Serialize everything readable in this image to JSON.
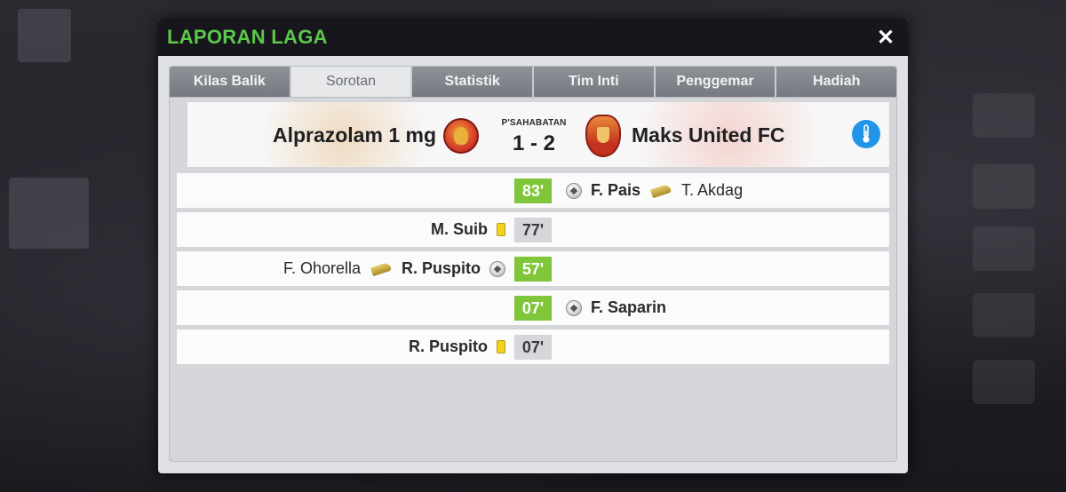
{
  "dialog": {
    "title": "LAPORAN LAGA",
    "close_label": "✕"
  },
  "tabs": [
    {
      "label": "Kilas Balik",
      "active": false
    },
    {
      "label": "Sorotan",
      "active": true
    },
    {
      "label": "Statistik",
      "active": false
    },
    {
      "label": "Tim Inti",
      "active": false
    },
    {
      "label": "Penggemar",
      "active": false
    },
    {
      "label": "Hadiah",
      "active": false
    }
  ],
  "match": {
    "home_team": "Alprazolam 1 mg",
    "away_team": "Maks United FC",
    "match_type": "P'SAHABATAN",
    "score": "1 - 2"
  },
  "events": [
    {
      "minute": "83'",
      "kind": "goal",
      "side": "away",
      "scorer": "F. Pais",
      "assist": "T. Akdag"
    },
    {
      "minute": "77'",
      "kind": "card",
      "side": "home",
      "player": "M. Suib"
    },
    {
      "minute": "57'",
      "kind": "goal",
      "side": "home",
      "scorer": "R. Puspito",
      "assist": "F. Ohorella"
    },
    {
      "minute": "07'",
      "kind": "goal",
      "side": "away",
      "scorer": "F. Saparin"
    },
    {
      "minute": "07'",
      "kind": "card",
      "side": "home",
      "player": "R. Puspito"
    }
  ],
  "colors": {
    "title_green": "#5cc84a",
    "goal_minute_bg": "#7fc63a",
    "card_minute_bg": "#d5d7da",
    "thermo_blue": "#2196e6",
    "yellow_card": "#f2d21f"
  },
  "icons": {
    "goal": "football-icon",
    "assist": "boot-icon",
    "card": "yellow-card-icon",
    "close": "close-icon",
    "weather": "thermometer-icon"
  }
}
